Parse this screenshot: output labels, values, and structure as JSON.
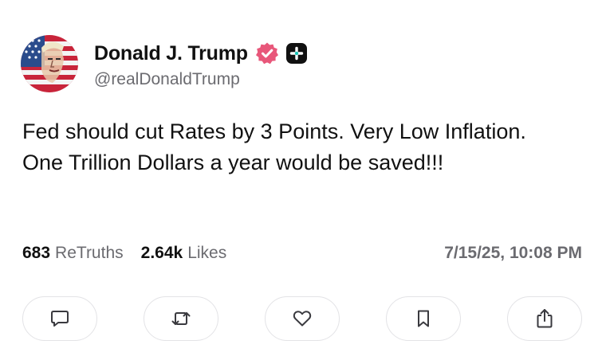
{
  "post": {
    "author": {
      "display_name": "Donald J. Trump",
      "handle": "@realDonaldTrump",
      "avatar_icon": "flag-portrait-avatar",
      "verified_icon": "verified-badge-icon",
      "plus_icon": "plus-badge-icon"
    },
    "text": "Fed should cut Rates by 3 Points. Very Low Inflation. One Trillion Dollars a year would be saved!!!",
    "stats": {
      "retruths_count": "683",
      "retruths_label": "ReTruths",
      "likes_count": "2.64k",
      "likes_label": "Likes"
    },
    "timestamp": "7/15/25, 10:08 PM",
    "actions": [
      {
        "name": "reply-button",
        "icon": "comment-icon"
      },
      {
        "name": "retruth-button",
        "icon": "repost-icon"
      },
      {
        "name": "like-button",
        "icon": "heart-icon"
      },
      {
        "name": "bookmark-button",
        "icon": "bookmark-icon"
      },
      {
        "name": "share-button",
        "icon": "share-icon"
      }
    ]
  },
  "colors": {
    "text": "#111111",
    "muted": "#6b6b70",
    "verified_pink": "#e8577a",
    "badge_dark": "#111111",
    "button_border": "#e3e3e6"
  }
}
